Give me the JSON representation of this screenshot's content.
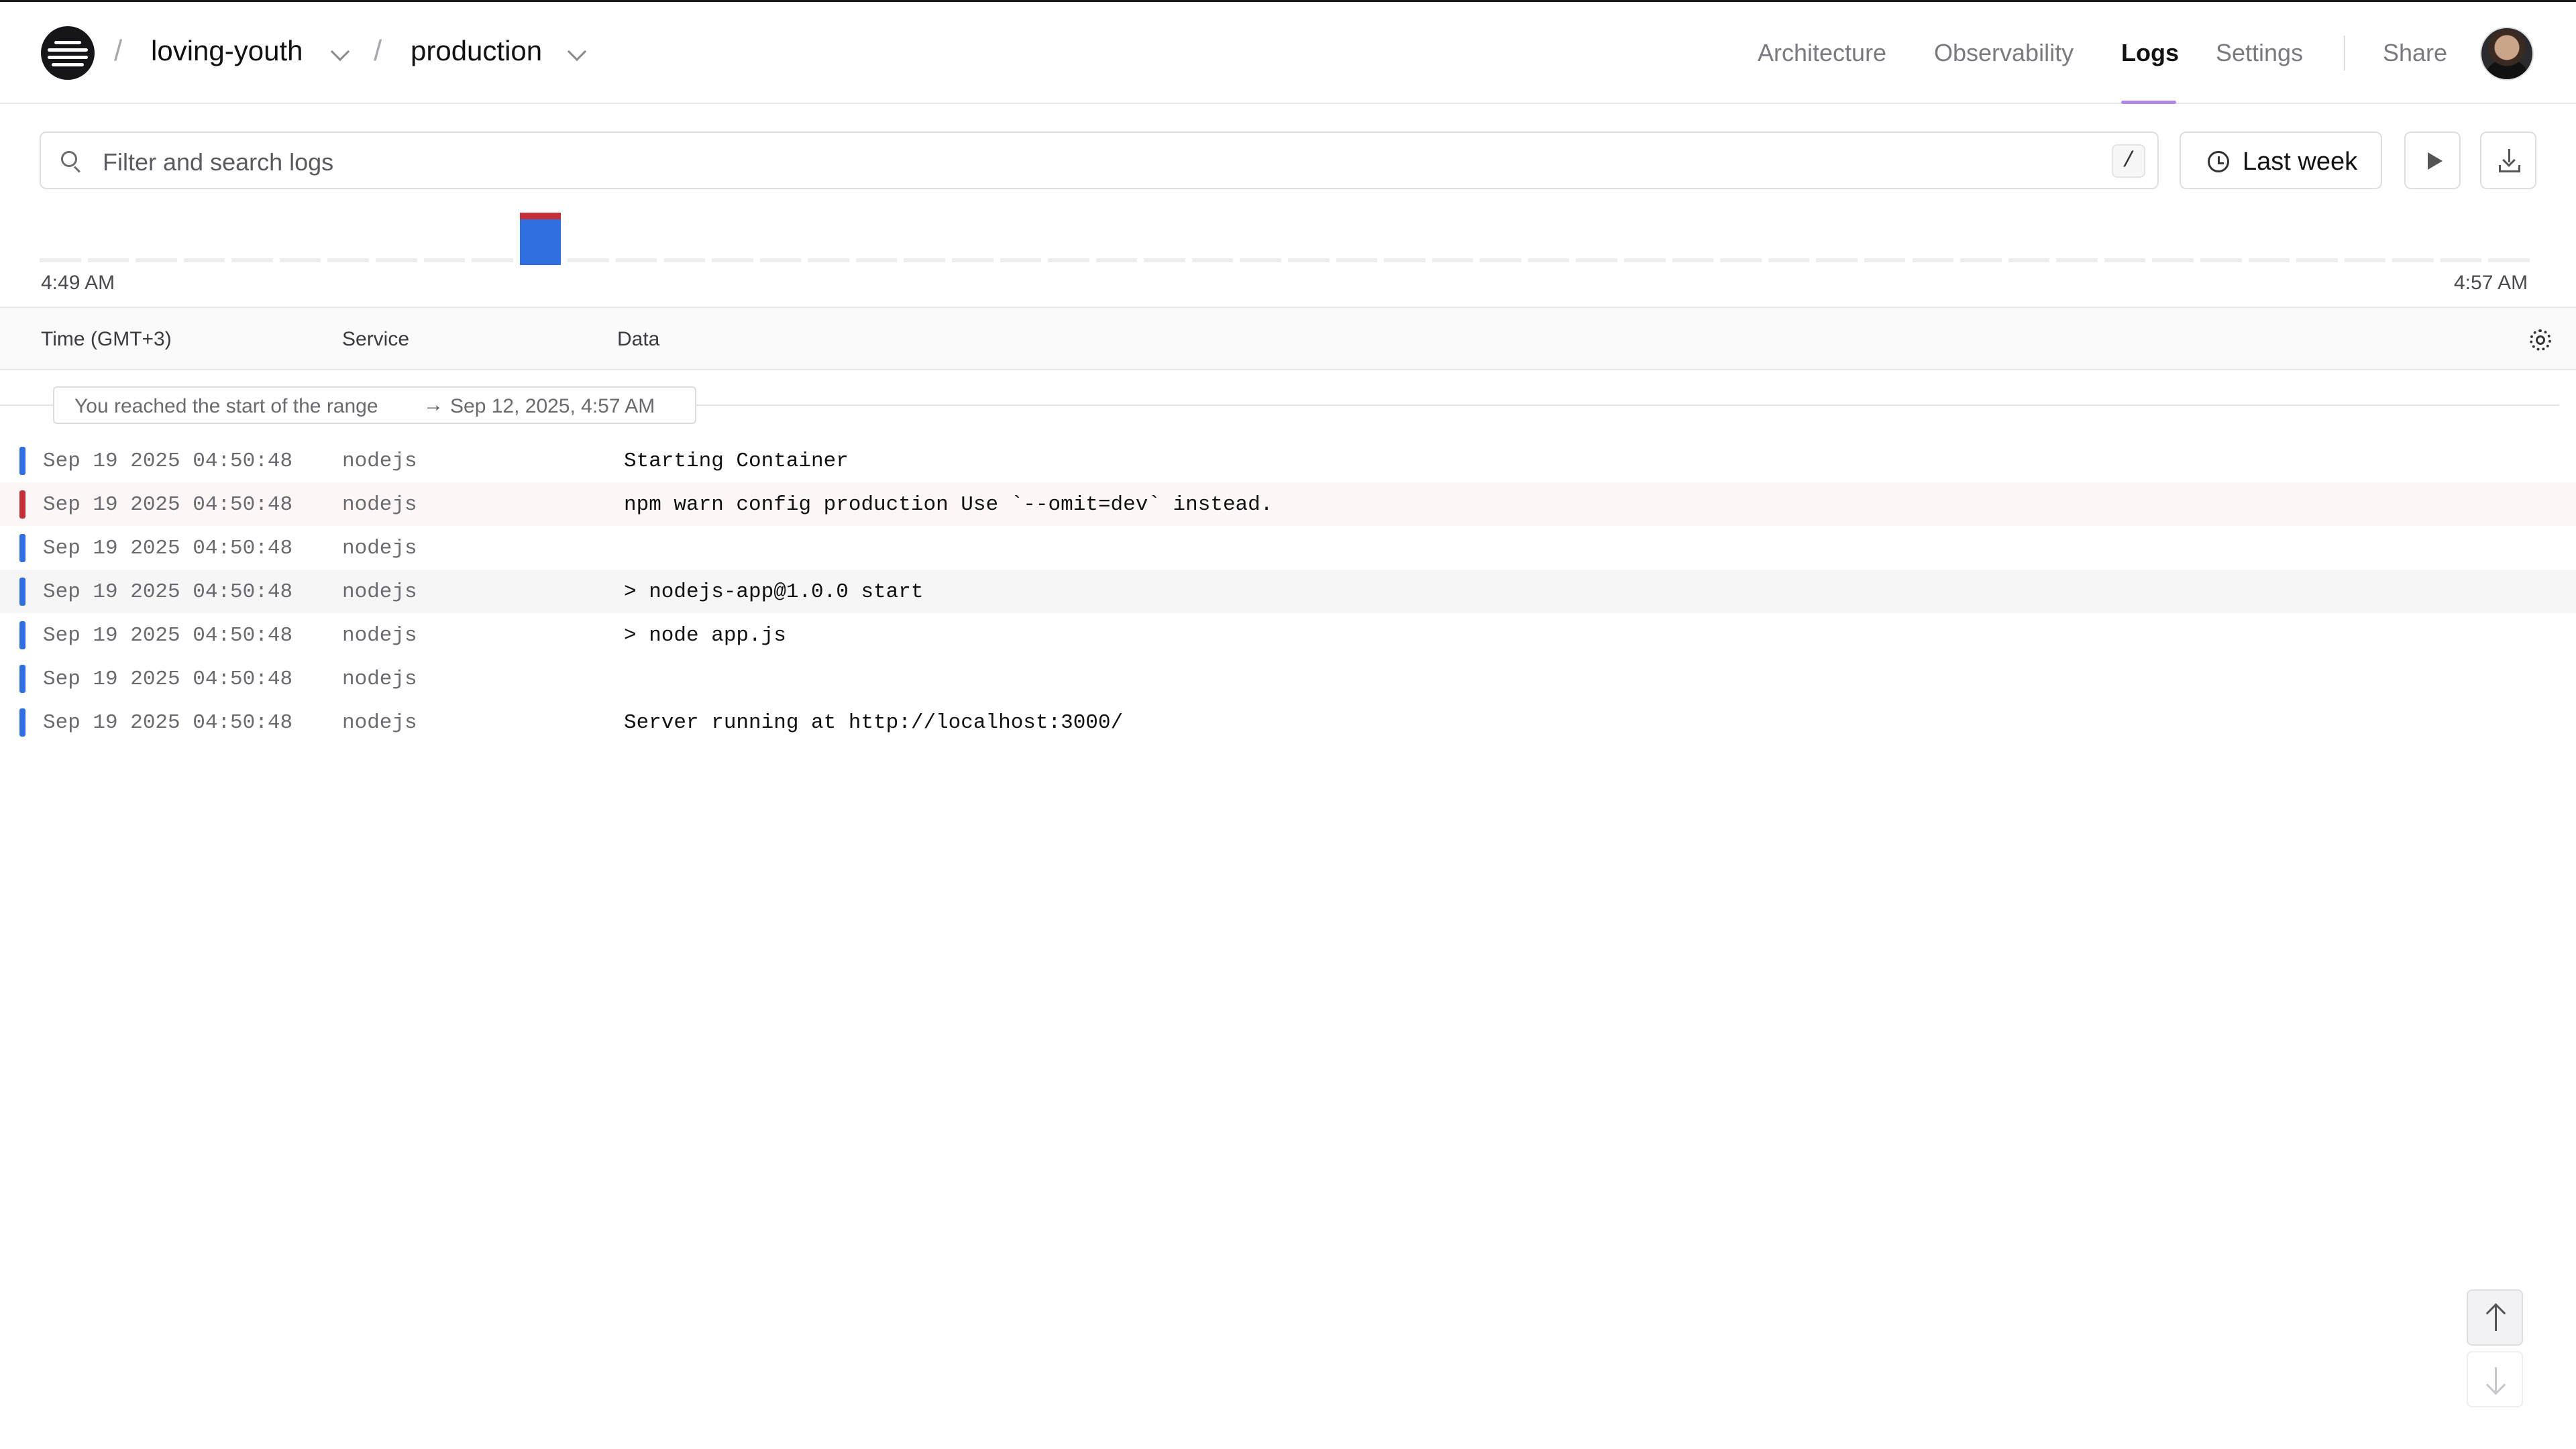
{
  "header": {
    "project": "loving-youth",
    "environment": "production",
    "crumb_separator": "/",
    "nav": [
      "Architecture",
      "Observability",
      "Logs",
      "Settings"
    ],
    "active_nav": "Logs",
    "share_label": "Share"
  },
  "toolbar": {
    "search_placeholder": "Filter and search logs",
    "search_shortcut": "/",
    "time_range": "Last week"
  },
  "histogram": {
    "start_label": "4:49 AM",
    "end_label": "4:57 AM",
    "bucket_count": 52,
    "active_bucket": 10,
    "info_count": 6,
    "error_count": 1,
    "colors": {
      "info": "#2f6fe0",
      "error": "#c4313b",
      "empty": "#eeeef0"
    }
  },
  "table": {
    "columns": [
      "Time (GMT+3)",
      "Service",
      "Data"
    ],
    "range_notice": {
      "text": "You reached the start of the range",
      "arrow": "→",
      "date": "Sep 12, 2025, 4:57 AM"
    },
    "rows": [
      {
        "time": "Sep 19 2025 04:50:48",
        "service": "nodejs",
        "data": "Starting Container",
        "level": "info"
      },
      {
        "time": "Sep 19 2025 04:50:48",
        "service": "nodejs",
        "data": "npm warn config production Use `--omit=dev` instead.",
        "level": "error"
      },
      {
        "time": "Sep 19 2025 04:50:48",
        "service": "nodejs",
        "data": "",
        "level": "info"
      },
      {
        "time": "Sep 19 2025 04:50:48",
        "service": "nodejs",
        "data": "> nodejs-app@1.0.0 start",
        "level": "info"
      },
      {
        "time": "Sep 19 2025 04:50:48",
        "service": "nodejs",
        "data": "> node app.js",
        "level": "info"
      },
      {
        "time": "Sep 19 2025 04:50:48",
        "service": "nodejs",
        "data": "",
        "level": "info"
      },
      {
        "time": "Sep 19 2025 04:50:48",
        "service": "nodejs",
        "data": "Server running at http://localhost:3000/",
        "level": "info"
      }
    ]
  }
}
